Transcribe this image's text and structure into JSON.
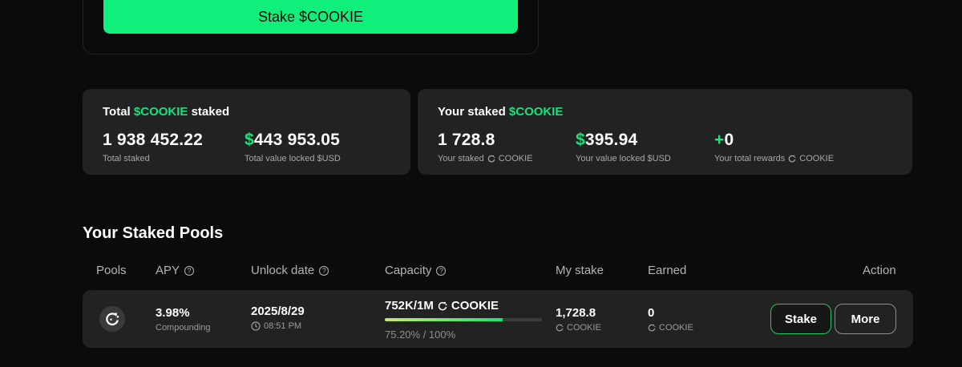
{
  "stake_button": {
    "label": "Stake $COOKIE"
  },
  "total_card": {
    "title_prefix": "Total ",
    "title_accent": "$COOKIE",
    "title_suffix": " staked",
    "total_staked": {
      "value": "1 938 452.22",
      "label": "Total staked"
    },
    "tvl": {
      "currency": "$",
      "value": "443 953.05",
      "label": "Total value locked $USD"
    }
  },
  "your_card": {
    "title_prefix": "Your staked ",
    "title_accent": "$COOKIE",
    "your_staked": {
      "value": "1 728.8",
      "label": "Your staked",
      "unit": "COOKIE"
    },
    "your_value": {
      "currency": "$",
      "value": "395.94",
      "label": "Your value locked $USD"
    },
    "rewards": {
      "sign": "+",
      "value": "0",
      "label": "Your total rewards",
      "unit": "COOKIE"
    }
  },
  "section_title": "Your Staked Pools",
  "table": {
    "headers": {
      "pools": "Pools",
      "apy": "APY",
      "unlock": "Unlock date",
      "capacity": "Capacity",
      "my_stake": "My stake",
      "earned": "Earned",
      "action": "Action"
    },
    "rows": [
      {
        "apy": "3.98%",
        "apy_sub": "Compounding",
        "unlock_date": "2025/8/29",
        "unlock_time": "08:51 PM",
        "capacity_prefix": "752K/1M",
        "capacity_unit": "COOKIE",
        "capacity_progress": 0.752,
        "capacity_percent_text": "75.20% / 100%",
        "my_stake": "1,728.8",
        "my_stake_unit": "COOKIE",
        "earned": "0",
        "earned_unit": "COOKIE",
        "stake_label": "Stake",
        "more_label": "More"
      }
    ]
  },
  "colors": {
    "accent": "#16e37a",
    "button_green": "#10ef7b",
    "card_bg": "#222222",
    "page_bg": "#0b0b0b"
  },
  "icons": {
    "cookie": "cookie-icon",
    "help": "help-circle-icon",
    "clock": "clock-icon"
  }
}
